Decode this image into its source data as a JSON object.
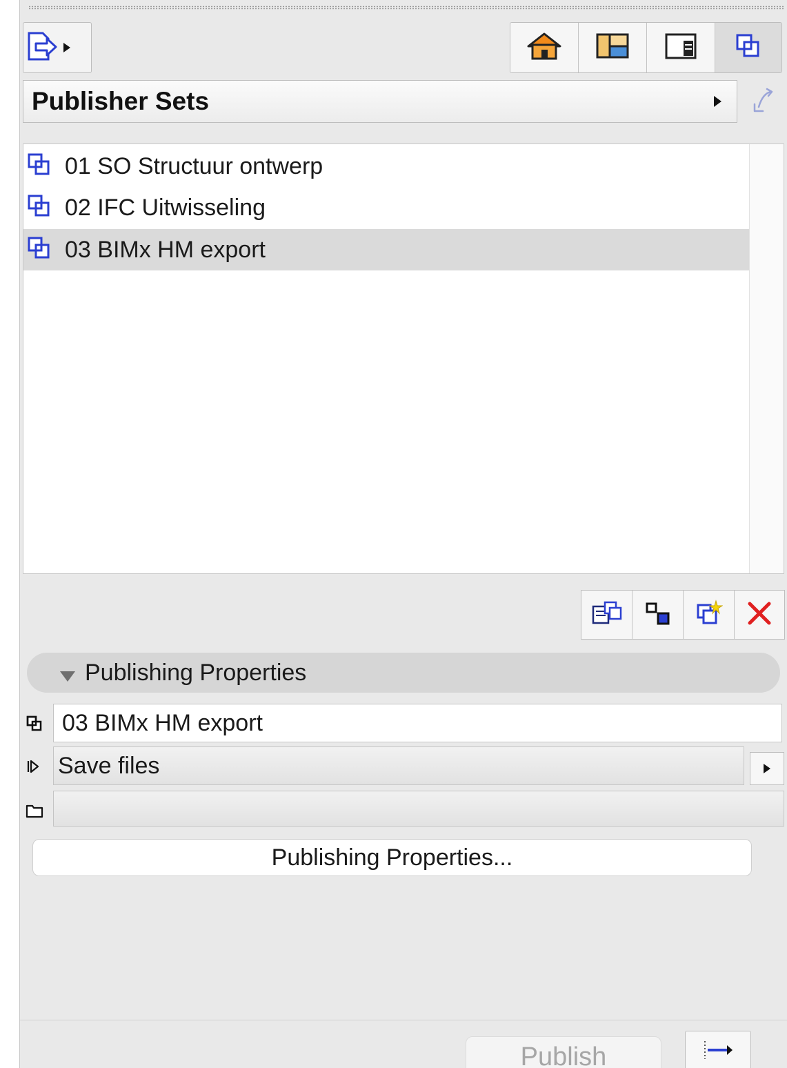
{
  "header": {
    "title": "Publisher Sets"
  },
  "toolbar": {
    "export_icon": "publish-export-icon",
    "nav_icons": [
      "project-map-icon",
      "view-map-icon",
      "layout-book-icon",
      "publisher-sets-icon"
    ]
  },
  "publisher_sets": {
    "items": [
      {
        "label": "01 SO Structuur ontwerp",
        "icon": "publisher-set-icon",
        "selected": false
      },
      {
        "label": "02 IFC Uitwisseling",
        "icon": "publisher-set-icon",
        "selected": false
      },
      {
        "label": "03 BIMx HM export",
        "icon": "publisher-set-icon",
        "selected": true
      }
    ]
  },
  "list_actions": {
    "icons": [
      "new-subset-icon",
      "new-folder-icon",
      "new-set-icon",
      "delete-icon"
    ]
  },
  "properties": {
    "section_label": "Publishing Properties",
    "name_value": "03 BIMx HM export",
    "method_value": "Save files",
    "path_value": "",
    "button_label": "Publishing Properties..."
  },
  "footer": {
    "publish_label": "Publish"
  },
  "colors": {
    "panel_bg": "#e9e9e9",
    "selection": "#dadada",
    "icon_blue": "#2b3fd1",
    "delete_red": "#e02020"
  }
}
